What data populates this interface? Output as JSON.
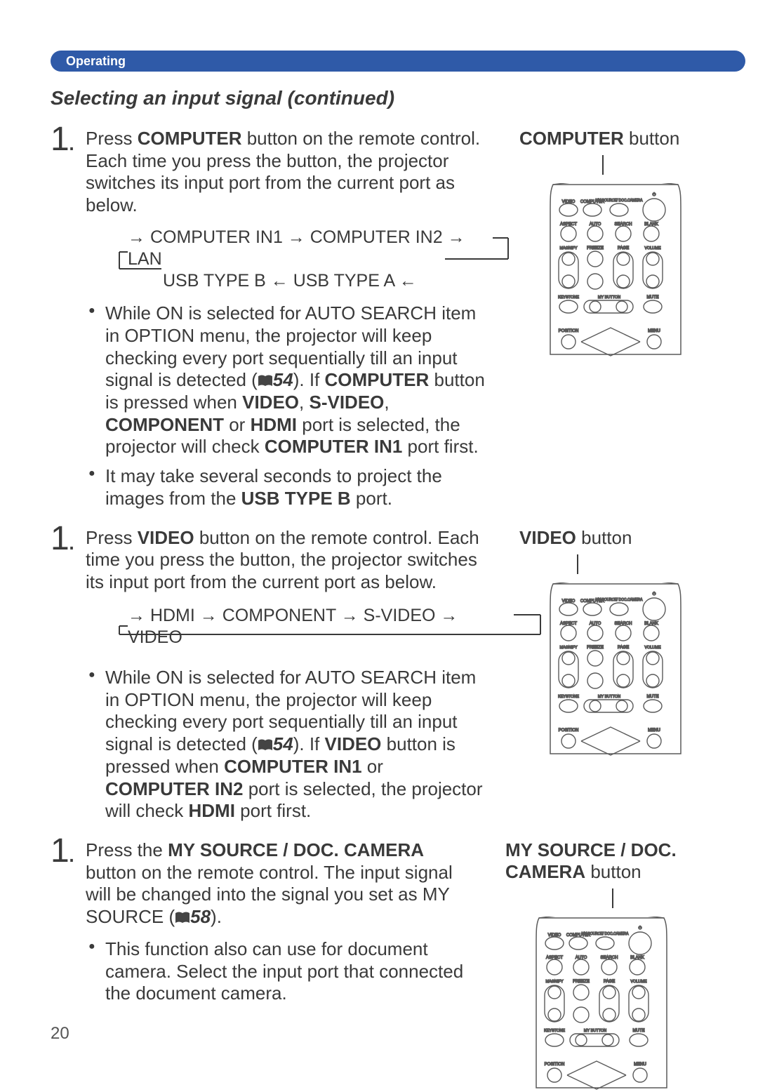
{
  "pill": "Operating",
  "section_title": "Selecting an input signal (continued)",
  "blocks": [
    {
      "num": "1",
      "intro_html": "Press <b>COMPUTER</b> button on the remote control. Each time you press the button, the projector switches its input port from the current port as below.",
      "flow_line1": "→ COMPUTER IN1 → COMPUTER IN2 → LAN",
      "flow_line2": "USB TYPE B   ←   USB TYPE A   ←",
      "bullet1_html": "While ON is selected for AUTO SEARCH item in OPTION menu, the projector will keep checking every port sequentially till an input signal is detected (📖<span class='ref'>54</span>). If <b>COMPUTER</b> button is pressed when <b>VIDEO</b>, <b>S-VIDEO</b>, <b>COMPONENT</b> or <b>HDMI</b> port is selected, the projector will check <b>COMPUTER IN1</b> port first.",
      "bullet2_html": "It may take several seconds to project the images from the <b>USB TYPE B</b> port.",
      "right_label_html": "<b>COMPUTER</b> button"
    },
    {
      "num": "1",
      "intro_html": "Press <b>VIDEO</b> button on the remote control. Each time you press the button, the projector switches its input port from the current port as below.",
      "flow_line1": "→ HDMI → COMPONENT → S-VIDEO → VIDEO",
      "flow_line2": "",
      "bullet1_html": "While ON is selected for AUTO SEARCH item in OPTION menu, the projector will keep checking every port sequentially till an input signal is detected (📖<span class='ref'>54</span>). If <b>VIDEO</b> button is pressed when <b>COMPUTER IN1</b> or <b>COMPUTER IN2</b> port is selected, the projector will check <b>HDMI</b> port first.",
      "bullet2_html": "",
      "right_label_html": "<b>VIDEO</b> button"
    },
    {
      "num": "1",
      "intro_html": "Press the <b>MY SOURCE / DOC. CAMERA</b> button on the remote control. The input signal will be changed into the signal you set as MY SOURCE (📖<span class='ref'>58</span>).",
      "flow_line1": "",
      "flow_line2": "",
      "bullet1_html": "This function also can use for document camera. Select the input port that connected the document camera.",
      "bullet2_html": "",
      "right_label_html": "<b>MY SOURCE / DOC. CAMERA</b> button"
    }
  ],
  "remote_labels": {
    "row1": [
      "VIDEO",
      "COMPUTER",
      "MY SOURCE/ DOC.CAMERA",
      ""
    ],
    "row2": [
      "ASPECT",
      "AUTO",
      "SEARCH",
      "BLANK"
    ],
    "row3": [
      "MAGNIFY",
      "FREEZE",
      "PAGE",
      "VOLUME"
    ],
    "row5": [
      "KEYSTONE",
      "MY BUTTON",
      "",
      "MUTE"
    ],
    "bottom": [
      "POSITION",
      "MENU"
    ]
  },
  "page_number": "20"
}
